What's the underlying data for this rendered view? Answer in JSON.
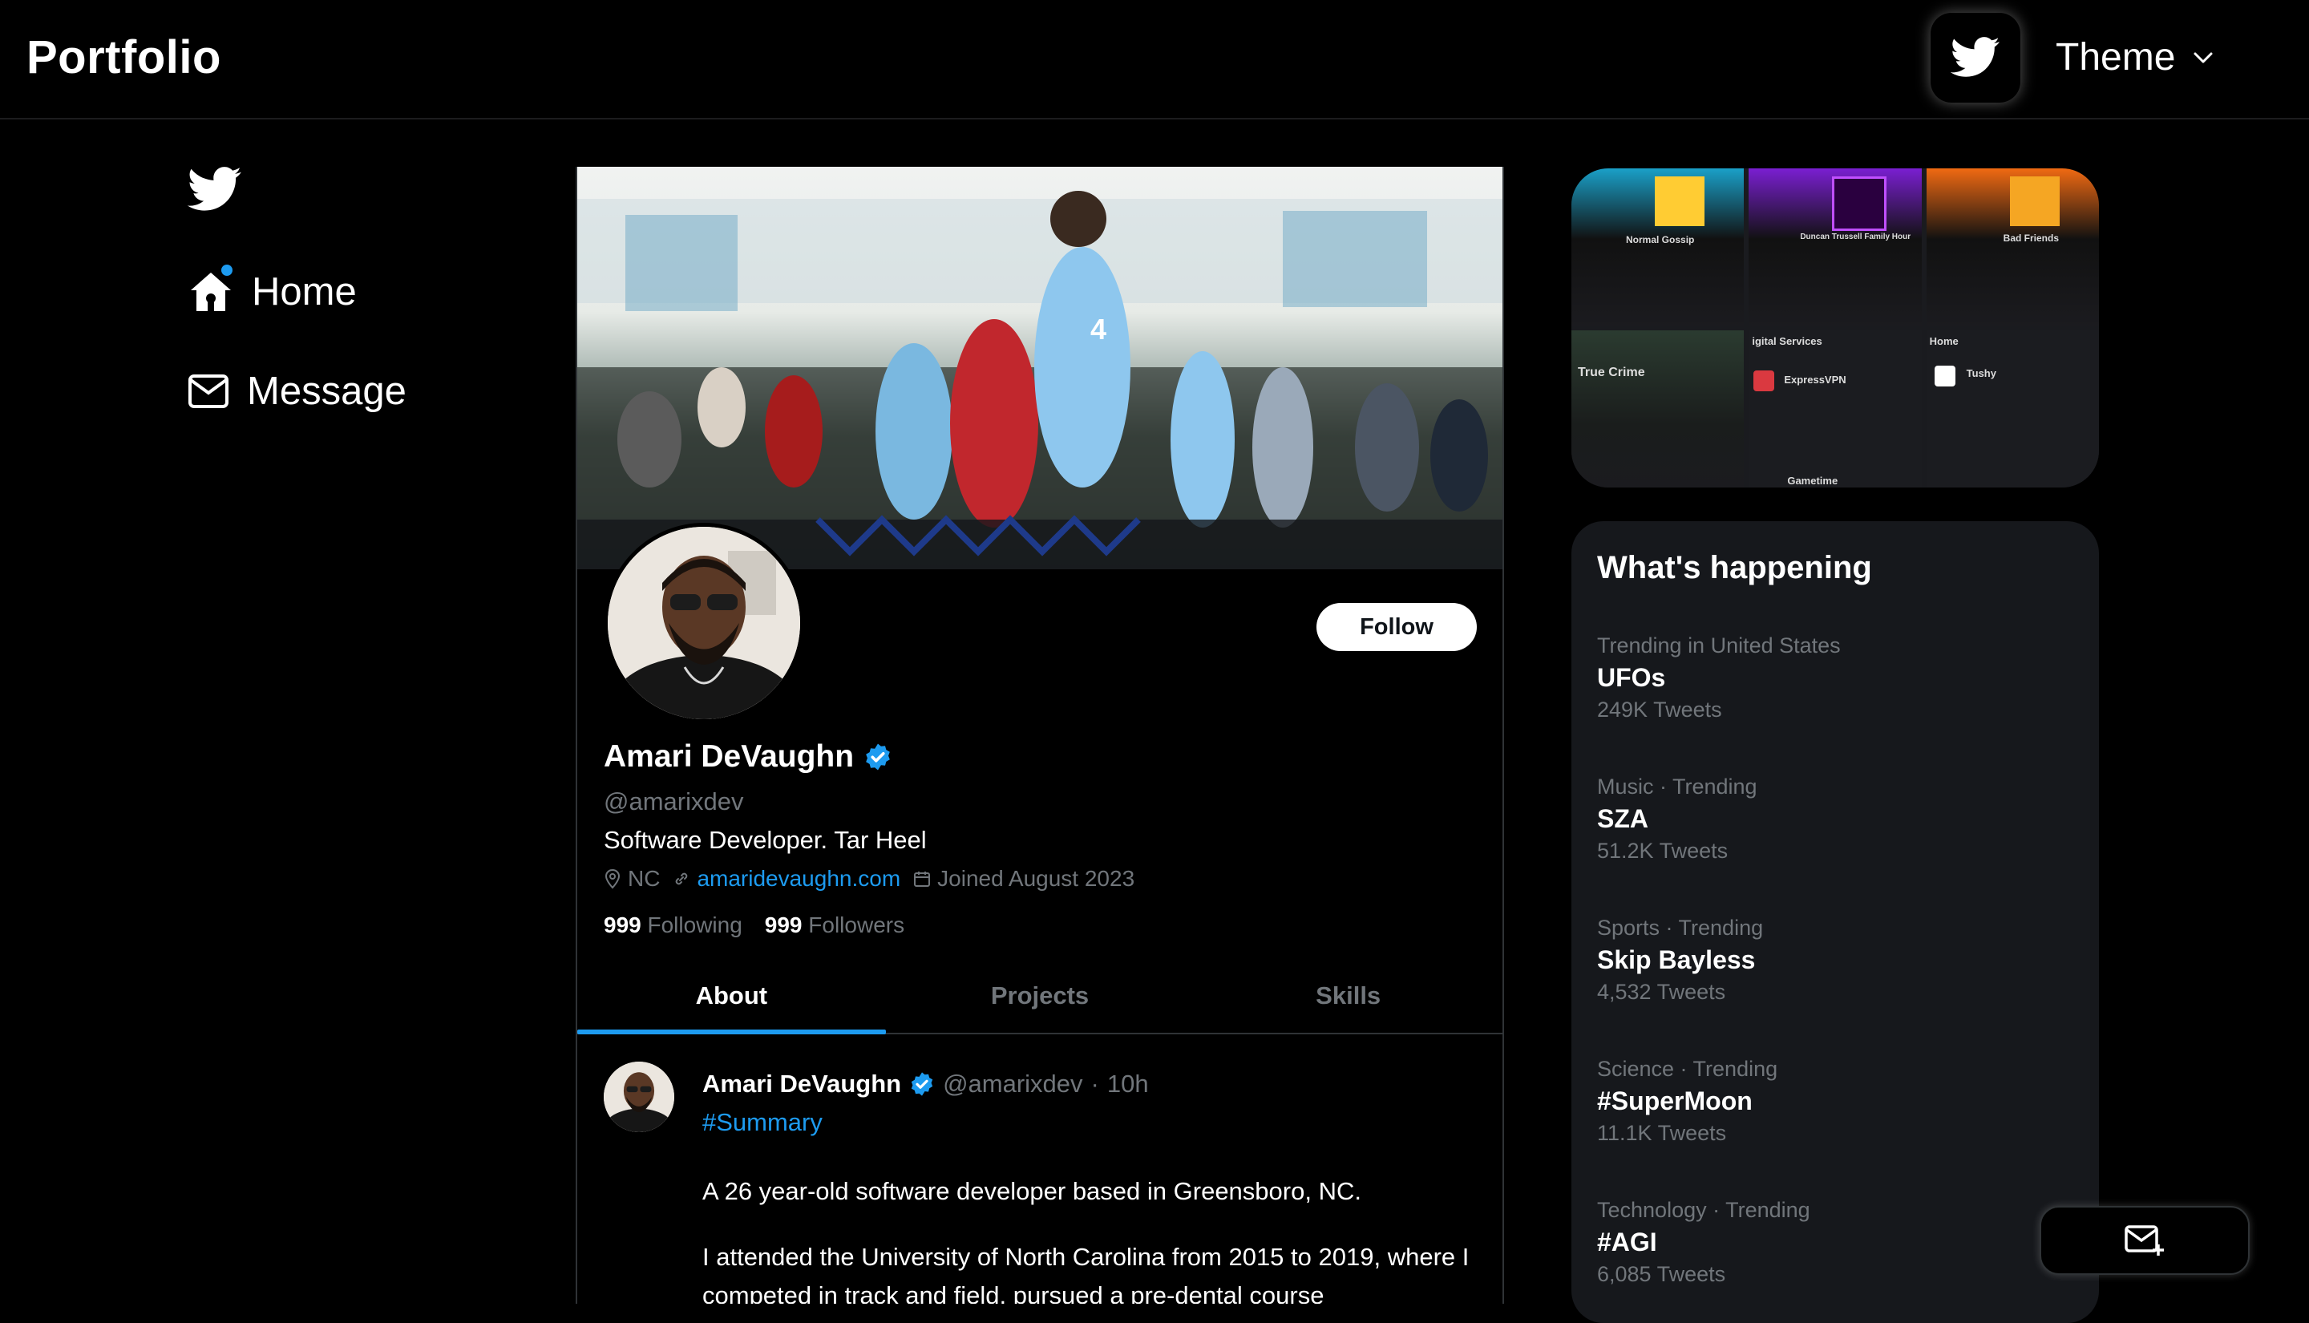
{
  "header": {
    "brand": "Portfolio",
    "theme_label": "Theme",
    "twitter_icon": "twitter-bird-icon",
    "theme_icon": "chevron-down-icon"
  },
  "sidebar": {
    "logo_icon": "twitter-bird-icon",
    "items": [
      {
        "label": "Home",
        "icon": "home-icon",
        "badge": true
      },
      {
        "label": "Message",
        "icon": "mail-icon"
      }
    ]
  },
  "profile": {
    "name": "Amari DeVaughn",
    "handle": "@amarixdev",
    "bio": "Software Developer. Tar Heel",
    "location": "NC",
    "website": "amaridevaughn.com",
    "joined": "Joined August 2023",
    "following_count": "999",
    "following_label": "Following",
    "followers_count": "999",
    "followers_label": "Followers",
    "follow_button": "Follow",
    "verified_icon": "verified-badge-icon"
  },
  "tabs": [
    {
      "label": "About",
      "active": true
    },
    {
      "label": "Projects",
      "active": false
    },
    {
      "label": "Skills",
      "active": false
    }
  ],
  "tweet": {
    "name": "Amari DeVaughn",
    "handle": "@amarixdev",
    "separator": "·",
    "time": "10h",
    "hashtag": "#Summary",
    "paragraphs": [
      "A 26 year-old software developer based in Greensboro, NC.",
      "I attended the University of North Carolina from 2015 to 2019, where I competed in track and field, pursued a pre-dental course"
    ]
  },
  "promo": {
    "cells": [
      {
        "label": "Normal Gossip"
      },
      {
        "label": "Duncan Trussell Family Hour"
      },
      {
        "label": "Bad Friends"
      },
      {
        "label": "True Crime"
      },
      {
        "label": "igital Services",
        "sublabel": "ExpressVPN",
        "sublabel2": "Gametime"
      },
      {
        "label": "Home",
        "sublabel": "Tushy"
      }
    ]
  },
  "happening": {
    "title": "What's happening",
    "trends": [
      {
        "context": "Trending in United States",
        "name": "UFOs",
        "count": "249K Tweets"
      },
      {
        "context": "Music · Trending",
        "name": "SZA",
        "count": "51.2K Tweets"
      },
      {
        "context": "Sports · Trending",
        "name": "Skip Bayless",
        "count": "4,532 Tweets"
      },
      {
        "context": "Science · Trending",
        "name": "#SuperMoon",
        "count": "11.1K Tweets"
      },
      {
        "context": "Technology · Trending",
        "name": "#AGI",
        "count": "6,085 Tweets"
      }
    ]
  },
  "compose": {
    "icon": "compose-mail-icon"
  },
  "colors": {
    "accent": "#1d9bf0",
    "background": "#000000",
    "panel": "#16181c",
    "muted": "#71767b",
    "border": "#2f3336"
  }
}
